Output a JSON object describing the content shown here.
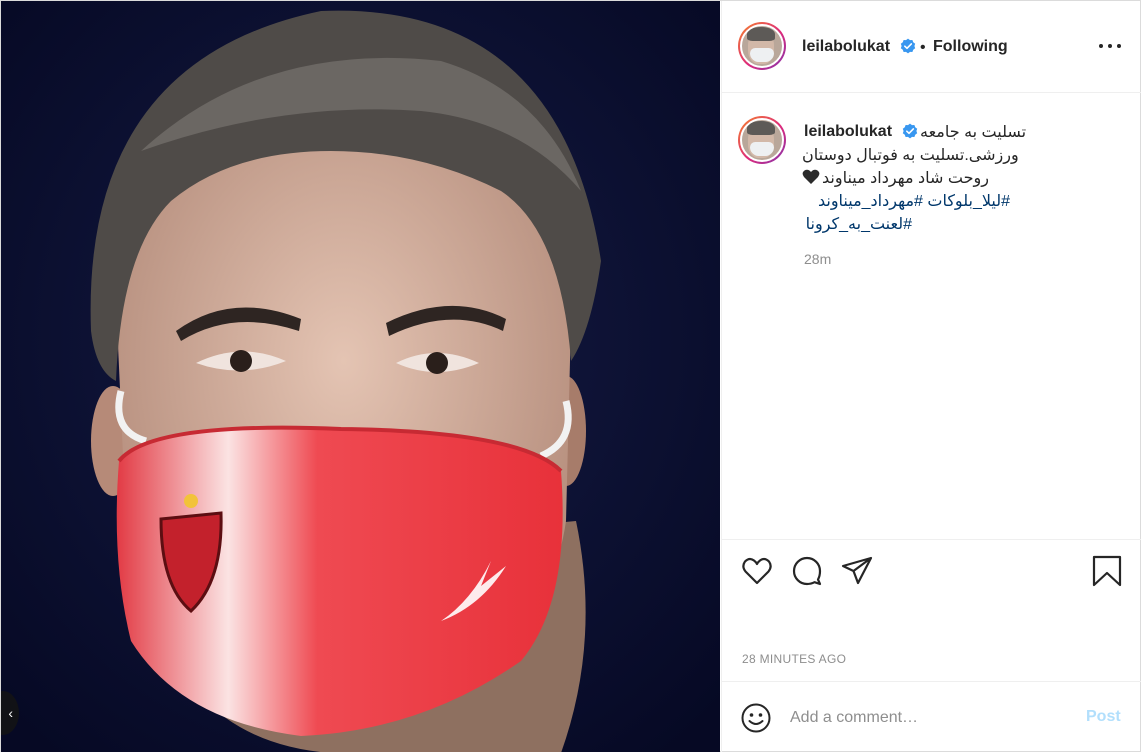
{
  "post": {
    "author": "leilabolukat",
    "verified": true,
    "follow_separator": "•",
    "follow_status": "Following",
    "more_icon": "more-horizontal-icon",
    "media": {
      "colors": {
        "background": "#0b0f2e",
        "mask": "#e8313a",
        "mask_light": "#fbd6d6",
        "skin": "#d9b7a6"
      }
    },
    "caption": {
      "lines": [
        "تسلیت به جامعه",
        "ورزشی.تسلیت به فوتبال دوستان",
        "روحت شاد مهرداد میناوند"
      ],
      "emoji": "black-heart",
      "hashtags": [
        "#لیلا_بلوکات",
        "#مهرداد_میناوند",
        "#لعنت_به_کرونا"
      ],
      "relative_time": "28m"
    },
    "actions": {
      "like_icon": "heart-outline-icon",
      "comment_icon": "comment-bubble-icon",
      "share_icon": "paper-plane-icon",
      "save_icon": "bookmark-icon"
    },
    "timestamp": "28 MINUTES AGO",
    "comment": {
      "emoji_icon": "smiley-icon",
      "placeholder": "Add a comment…",
      "post_label": "Post"
    },
    "colors": {
      "text": "#262626",
      "muted": "#8e8e8e",
      "link": "#00376b",
      "verified": "#3897f0",
      "post_disabled": "#b2dffc"
    }
  }
}
